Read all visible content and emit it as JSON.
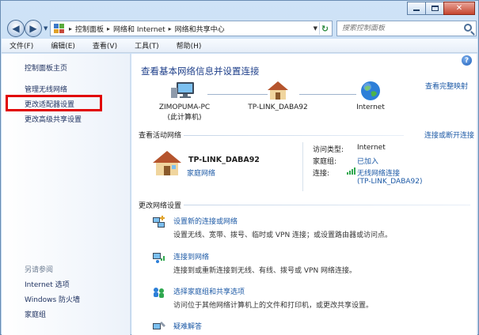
{
  "window": {
    "controls": {
      "minimize": "",
      "maximize": "",
      "close": "✕"
    }
  },
  "nav": {
    "back_glyph": "◀",
    "forward_glyph": "▶",
    "breadcrumbs": [
      "控制面板",
      "网络和 Internet",
      "网络和共享中心"
    ],
    "search_placeholder": "搜索控制面板",
    "refresh_glyph": "↻"
  },
  "menu": [
    "文件(F)",
    "编辑(E)",
    "查看(V)",
    "工具(T)",
    "帮助(H)"
  ],
  "sidebar": {
    "home": "控制面板主页",
    "links": [
      "管理无线网络",
      "更改适配器设置",
      "更改高级共享设置"
    ],
    "highlighted": "更改适配器设置",
    "see_also_title": "另请参阅",
    "see_also": [
      "Internet 选项",
      "Windows 防火墙",
      "家庭组"
    ]
  },
  "main": {
    "help_glyph": "?",
    "title": "查看基本网络信息并设置连接",
    "full_map_link": "查看完整映射",
    "map_nodes": [
      {
        "name": "ZIMOPUMA-PC",
        "sub": "(此计算机)",
        "icon": "computer-icon"
      },
      {
        "name": "TP-LINK_DABA92",
        "sub": "",
        "icon": "house-icon"
      },
      {
        "name": "Internet",
        "sub": "",
        "icon": "globe-icon"
      }
    ],
    "active_networks": {
      "heading": "查看活动网络",
      "action": "连接或断开连接",
      "network_name": "TP-LINK_DABA92",
      "network_type": "家庭网络",
      "access_type_label": "访问类型:",
      "access_type_value": "Internet",
      "homegroup_label": "家庭组:",
      "homegroup_value": "已加入",
      "connections_label": "连接:",
      "connection_value_1": "无线网络连接",
      "connection_value_2": "(TP-LINK_DABA92)"
    },
    "change_settings": {
      "heading": "更改网络设置",
      "tasks": [
        {
          "title": "设置新的连接或网络",
          "desc": "设置无线、宽带、拨号、临时或 VPN 连接；或设置路由器或访问点。",
          "icon": "new-connection-icon"
        },
        {
          "title": "连接到网络",
          "desc": "连接到或重新连接到无线、有线、拨号或 VPN 网络连接。",
          "icon": "connect-network-icon"
        },
        {
          "title": "选择家庭组和共享选项",
          "desc": "访问位于其他网络计算机上的文件和打印机，或更改共享设置。",
          "icon": "homegroup-icon"
        },
        {
          "title": "疑难解答",
          "desc": "",
          "icon": "troubleshoot-icon"
        }
      ]
    }
  },
  "colors": {
    "link": "#1d5aa6",
    "title": "#1e3f8a",
    "highlight_box": "#e10000",
    "signal_green": "#2fa84f"
  }
}
